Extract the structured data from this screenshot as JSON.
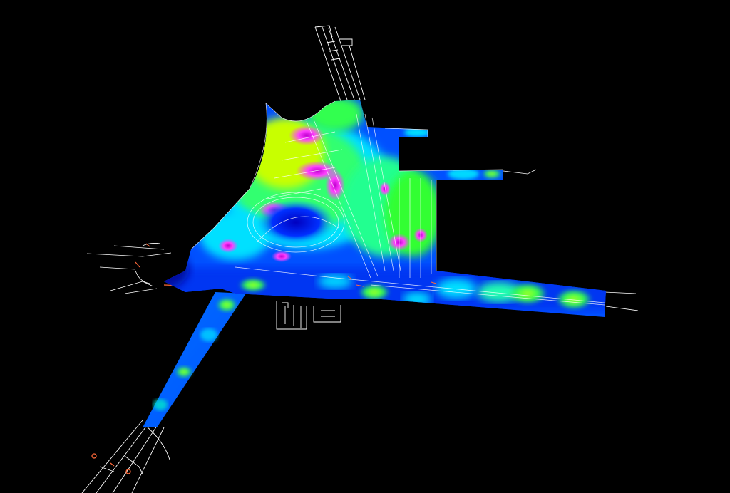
{
  "view": {
    "kind": "3d-heatmap-over-cad-plan",
    "background": "#000000",
    "linework_color": "#ffffff",
    "accent_linework_color": "#ff6a3a"
  },
  "colormap": {
    "name": "jet-like",
    "stops": [
      "#0000c8",
      "#0040ff",
      "#00aaff",
      "#00ffcc",
      "#30ff30",
      "#c8ff00",
      "#ff40ff",
      "#b000c0"
    ],
    "note_visible_labels": []
  },
  "regions": [
    {
      "id": "north-road",
      "label": ""
    },
    {
      "id": "central-plaza",
      "label": ""
    },
    {
      "id": "east-arm",
      "label": ""
    },
    {
      "id": "east-upper-arm",
      "label": ""
    },
    {
      "id": "west-junction",
      "label": ""
    },
    {
      "id": "southwest-road",
      "label": ""
    },
    {
      "id": "roundabout",
      "label": ""
    },
    {
      "id": "building-south",
      "label": ""
    }
  ]
}
